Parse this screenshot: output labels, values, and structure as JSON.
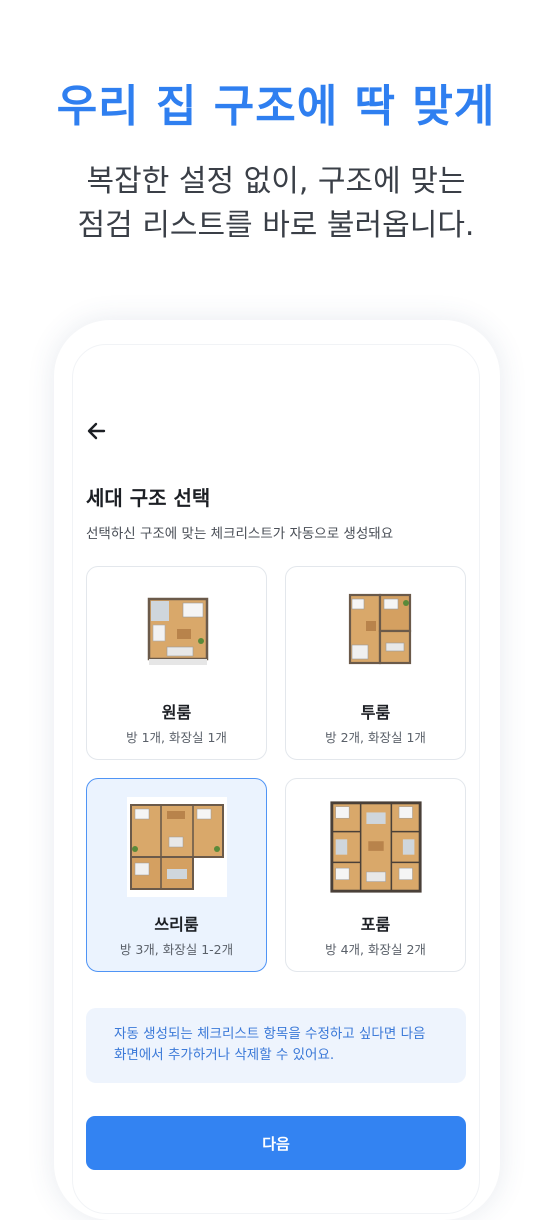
{
  "promo": {
    "title": "우리 집 구조에 딱 맞게",
    "subtitle_line1": "복잡한 설정 없이, 구조에 맞는",
    "subtitle_line2": "점검 리스트를 바로 불러옵니다."
  },
  "screen": {
    "title": "세대 구조 선택",
    "description": "선택하신 구조에 맞는 체크리스트가 자동으로 생성돼요",
    "options": [
      {
        "name": "원룸",
        "info": "방 1개, 화장실 1개",
        "selected": false
      },
      {
        "name": "투룸",
        "info": "방 2개, 화장실 1개",
        "selected": false
      },
      {
        "name": "쓰리룸",
        "info": "방 3개, 화장실 1-2개",
        "selected": true
      },
      {
        "name": "포룸",
        "info": "방 4개, 화장실 2개",
        "selected": false
      }
    ],
    "notice_line1": "자동 생성되는 체크리스트 항목을 수정하고 싶다면 다음",
    "notice_line2": "화면에서 추가하거나 삭제할 수 있어요.",
    "next_label": "다음"
  },
  "colors": {
    "accent": "#2f7ff0",
    "button": "#3383f2",
    "selected_bg": "#ebf3fe",
    "selected_border": "#4f94f5"
  },
  "icons": {
    "back": "arrow-left-icon"
  }
}
